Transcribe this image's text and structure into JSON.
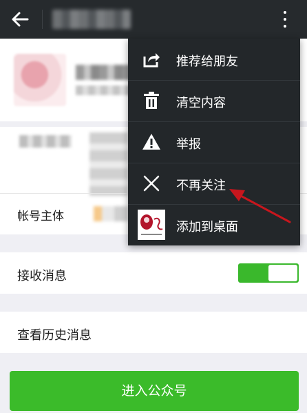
{
  "topbar": {
    "back_icon": "arrow-left-icon",
    "more_icon": "more-vertical-icon"
  },
  "info": {
    "account_owner_label": "帐号主体"
  },
  "settings": {
    "receive_messages_label": "接收消息",
    "receive_messages_on": true,
    "history_label": "查看历史消息"
  },
  "enter_button_label": "进入公众号",
  "menu": {
    "items": [
      {
        "label": "推荐给朋友",
        "icon": "share-icon"
      },
      {
        "label": "清空内容",
        "icon": "trash-icon"
      },
      {
        "label": "举报",
        "icon": "warning-icon"
      },
      {
        "label": "不再关注",
        "icon": "close-icon"
      },
      {
        "label": "添加到桌面",
        "icon": "app-thumbnail-icon"
      }
    ]
  },
  "colors": {
    "topbar": "#262a2d",
    "menu": "#23272a",
    "accent_green": "#3bbb2a",
    "annotation_arrow": "#c8161d"
  }
}
